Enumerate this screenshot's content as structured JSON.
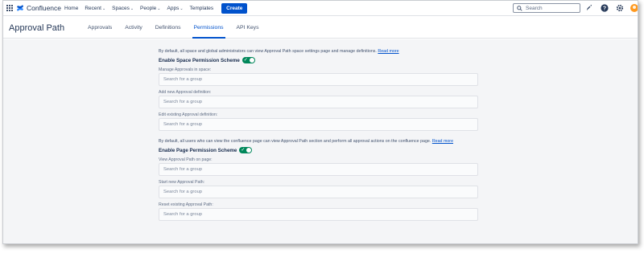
{
  "topnav": {
    "logo_text": "Confluence",
    "items": [
      {
        "label": "Home",
        "dropdown": false
      },
      {
        "label": "Recent",
        "dropdown": true
      },
      {
        "label": "Spaces",
        "dropdown": true
      },
      {
        "label": "People",
        "dropdown": true
      },
      {
        "label": "Apps",
        "dropdown": true
      },
      {
        "label": "Templates",
        "dropdown": false
      }
    ],
    "create_label": "Create",
    "search_placeholder": "Search",
    "icons": [
      "notifications-icon",
      "help-icon",
      "settings-icon",
      "avatar"
    ]
  },
  "header": {
    "title": "Approval Path",
    "tabs": [
      "Approvals",
      "Activity",
      "Definitions",
      "Permissions",
      "API Keys"
    ],
    "active_tab": "Permissions"
  },
  "space_section": {
    "info_text": "By default, all space and global administrators can view Approval Path space settings page and manage definitions.",
    "read_more": "Read more",
    "toggle_label": "Enable Space Permission Scheme",
    "toggle_on": true,
    "fields": [
      {
        "label": "Manage Approvals in space:",
        "placeholder": "Search for a group"
      },
      {
        "label": "Add new Approval definition:",
        "placeholder": "Search for a group"
      },
      {
        "label": "Edit existing Approval definition:",
        "placeholder": "Search for a group"
      }
    ]
  },
  "page_section": {
    "info_text": "By default, all users who can view the confluence page can view Approval Path section and perform all approval actions on the confluence page.",
    "read_more": "Read more",
    "toggle_label": "Enable Page Permission Scheme",
    "toggle_on": true,
    "fields": [
      {
        "label": "View Approval Path on page:",
        "placeholder": "Search for a group"
      },
      {
        "label": "Start new Approval Path:",
        "placeholder": "Search for a group"
      },
      {
        "label": "Reset existing Approval Path:",
        "placeholder": "Search for a group"
      }
    ]
  },
  "colors": {
    "accent": "#0052cc",
    "toggle_on": "#00875a",
    "content_bg": "#f4f5f7",
    "avatar": "#ff991f"
  }
}
